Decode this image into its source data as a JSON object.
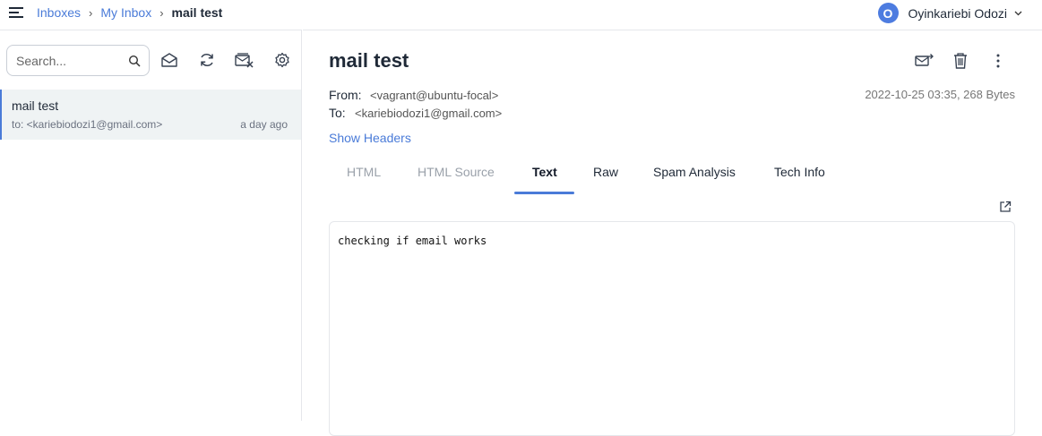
{
  "breadcrumb": {
    "items": [
      "Inboxes",
      "My Inbox"
    ],
    "current": "mail test"
  },
  "user": {
    "initial": "O",
    "name": "Oyinkariebi Odozi"
  },
  "toolbar": {
    "search_placeholder": "Search...",
    "icons": [
      "search-icon",
      "mark-read-icon",
      "refresh-icon",
      "clear-inbox-icon",
      "settings-icon"
    ]
  },
  "mail_list": [
    {
      "subject": "mail test",
      "to": "to: <kariebiodozi1@gmail.com>",
      "time": "a day ago"
    }
  ],
  "message": {
    "subject": "mail test",
    "from_label": "From:",
    "from": "<vagrant@ubuntu-focal>",
    "to_label": "To:",
    "to": "<kariebiodozi1@gmail.com>",
    "date_size": "2022-10-25 03:35, 268 Bytes",
    "show_headers": "Show Headers",
    "tabs": [
      "HTML",
      "HTML Source",
      "Text",
      "Raw",
      "Spam Analysis",
      "Tech Info"
    ],
    "active_tab": "Text",
    "body": "checking if email works"
  },
  "colors": {
    "accent": "#4a7bd8",
    "selected_row": "#eff3f4"
  }
}
